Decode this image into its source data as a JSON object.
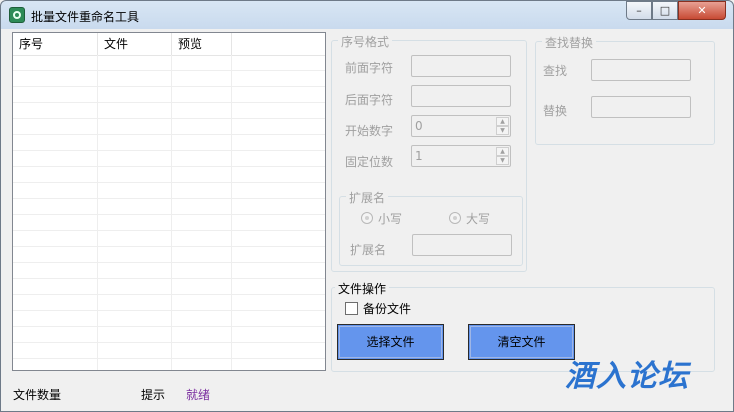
{
  "window": {
    "title": "批量文件重命名工具",
    "controls": {
      "minimize": "–",
      "maximize": "□",
      "close": "✕"
    }
  },
  "list": {
    "columns": [
      "序号",
      "文件",
      "预览"
    ]
  },
  "serial_format": {
    "title": "序号格式",
    "prefix_label": "前面字符",
    "suffix_label": "后面字符",
    "start_label": "开始数字",
    "start_value": "0",
    "digits_label": "固定位数",
    "digits_value": "1"
  },
  "extension": {
    "title": "扩展名",
    "lowercase_label": "小写",
    "uppercase_label": "大写",
    "ext_label": "扩展名"
  },
  "find_replace": {
    "title": "查找替换",
    "find_label": "查找",
    "replace_label": "替换"
  },
  "file_ops": {
    "title": "文件操作",
    "backup_label": "备份文件",
    "select_button": "选择文件",
    "clear_button": "清空文件"
  },
  "status": {
    "file_count_label": "文件数量",
    "hint_label": "提示",
    "hint_value": "就绪"
  },
  "watermark": "酒入论坛"
}
